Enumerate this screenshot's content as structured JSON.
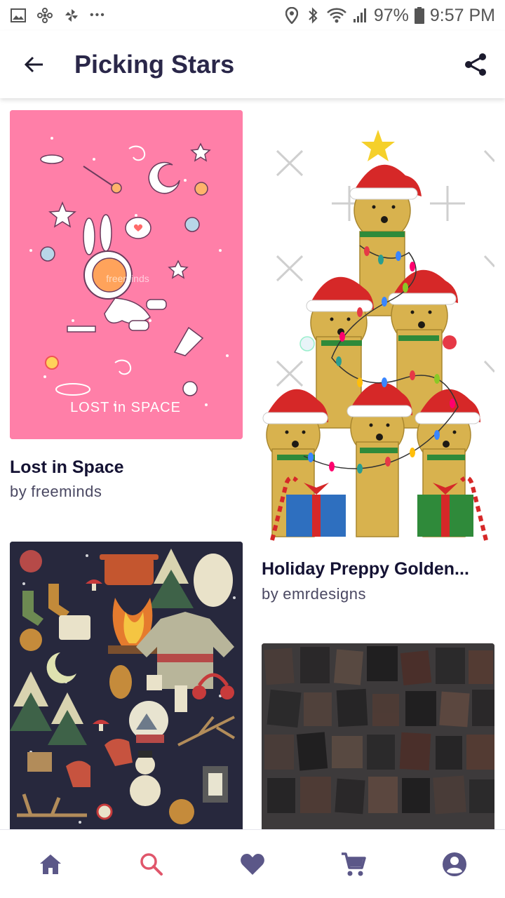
{
  "status_bar": {
    "battery": "97%",
    "time": "9:57 PM",
    "more": "•••",
    "icons": [
      "gallery-icon",
      "fan-icon",
      "pinwheel-icon",
      "location-icon",
      "bluetooth-icon",
      "wifi-icon",
      "signal-icon",
      "battery-icon"
    ]
  },
  "app_bar": {
    "title": "Picking Stars",
    "back_icon": "arrow-left-icon",
    "share_icon": "share-icon"
  },
  "cards": [
    {
      "title": "Lost in Space",
      "by": "by",
      "artist": "freeminds",
      "image_text": "LOST in SPACE",
      "watermark": "freeminds",
      "bg_color": "#ff7fa8"
    },
    {
      "title": "Holiday Preppy Golden...",
      "by": "by",
      "artist": "emrdesigns",
      "bg_color": "#ffffff"
    },
    {
      "title": "",
      "by": "",
      "artist": "",
      "bg_color": "#27283d"
    },
    {
      "title": "",
      "by": "",
      "artist": "",
      "bg_color": "#3d3a3b"
    }
  ],
  "bottom_nav": {
    "items": [
      "home-icon",
      "search-icon",
      "heart-icon",
      "cart-icon",
      "account-icon"
    ],
    "active": "search-icon",
    "active_color": "#e0566b",
    "inactive_color": "#5b5788"
  },
  "colors": {
    "title_text": "#2a2749",
    "artist_text": "#4a4862"
  }
}
